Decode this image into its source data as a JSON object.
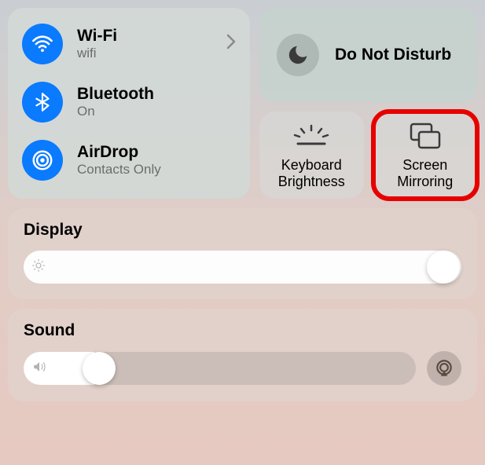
{
  "connectivity": {
    "wifi": {
      "title": "Wi-Fi",
      "subtitle": "wifi"
    },
    "bluetooth": {
      "title": "Bluetooth",
      "subtitle": "On"
    },
    "airdrop": {
      "title": "AirDrop",
      "subtitle": "Contacts Only"
    }
  },
  "dnd": {
    "title": "Do Not Disturb"
  },
  "tiles": {
    "keyboard_brightness": "Keyboard Brightness",
    "screen_mirroring": "Screen Mirroring"
  },
  "display": {
    "title": "Display",
    "value_percent": 95
  },
  "sound": {
    "title": "Sound",
    "value_percent": 18
  },
  "colors": {
    "accent": "#0a7aff",
    "highlight": "#e60000"
  }
}
